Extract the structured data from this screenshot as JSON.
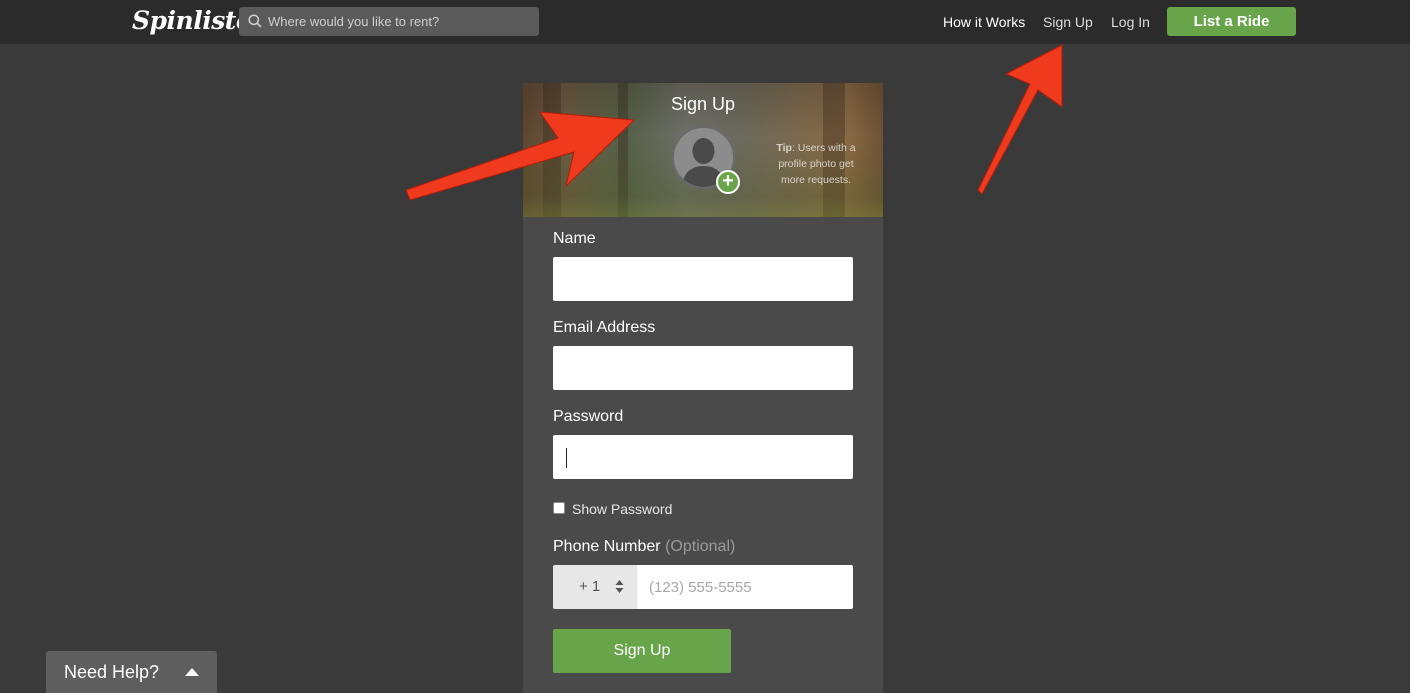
{
  "nav": {
    "logo": "Spinlister",
    "search_placeholder": "Where would you like to rent?",
    "links": [
      "How it Works",
      "Sign Up",
      "Log In"
    ],
    "cta": "List a Ride"
  },
  "signup": {
    "title": "Sign Up",
    "tip_label": "Tip",
    "tip_text": ": Users with a profile photo get more requests.",
    "fields": {
      "name_label": "Name",
      "email_label": "Email Address",
      "password_label": "Password",
      "show_password_label": "Show Password",
      "phone_label": "Phone Number",
      "phone_optional": "(Optional)",
      "phone_code": "+ 1",
      "phone_placeholder": "(123) 555-5555"
    },
    "submit_label": "Sign Up"
  },
  "help": {
    "label": "Need Help?"
  },
  "colors": {
    "accent_green": "#68a54a",
    "nav_bg": "#2b2b2b",
    "page_bg": "#3a3a3a",
    "panel_bg": "#4a4a4a",
    "annotation_red": "#f03a1e"
  },
  "icons": {
    "search": "search-icon",
    "avatar": "user-silhouette-icon",
    "add": "plus-icon",
    "select_arrows": "sort-arrows-icon",
    "help_toggle": "caret-up-icon"
  }
}
